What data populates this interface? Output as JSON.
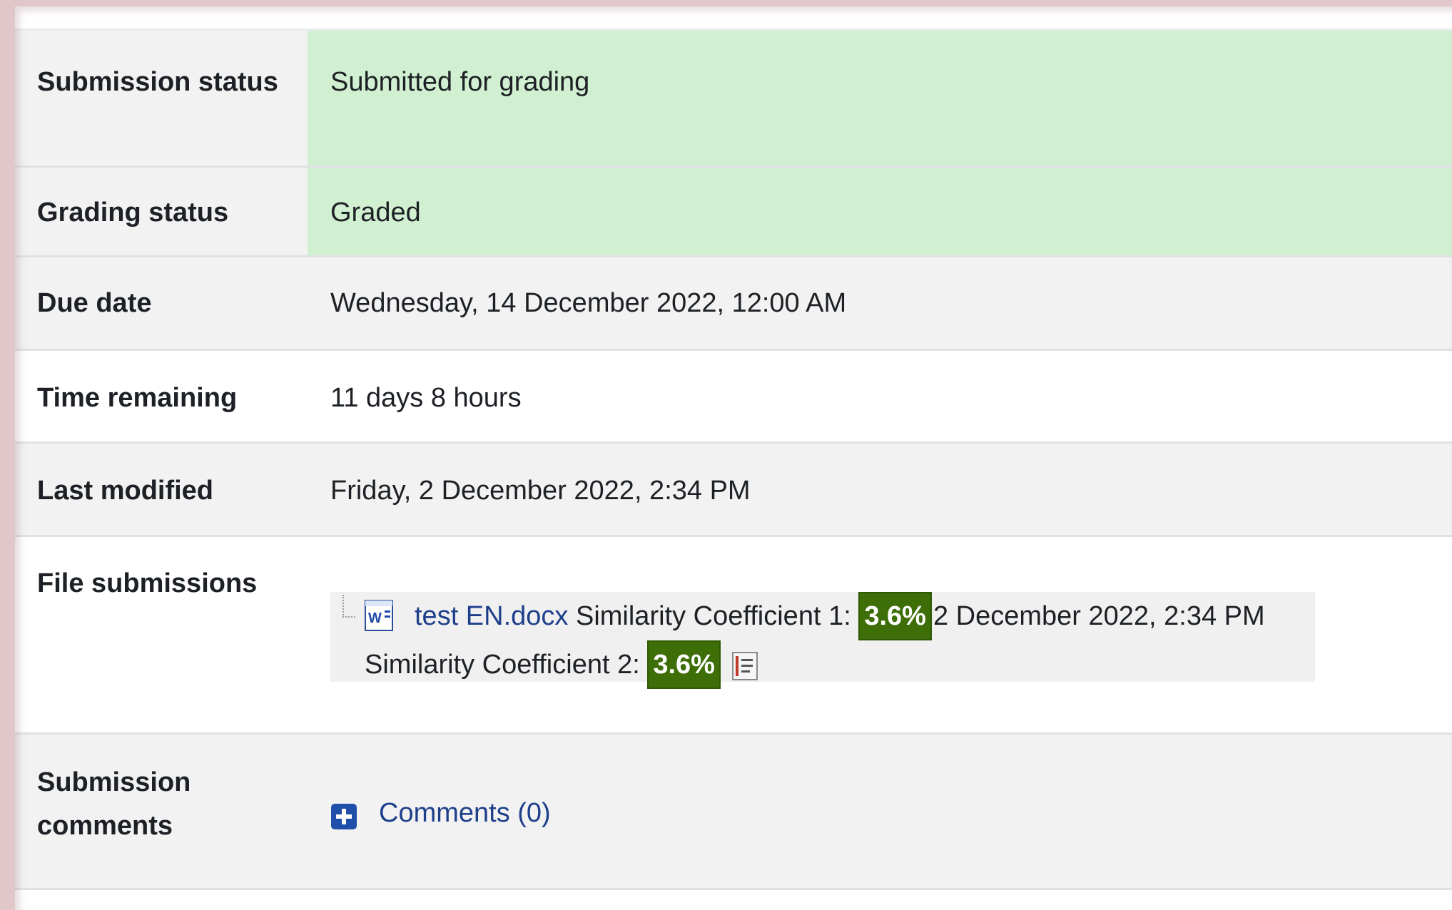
{
  "status": {
    "submission_status": {
      "label": "Submission status",
      "value": "Submitted for grading"
    },
    "grading_status": {
      "label": "Grading status",
      "value": "Graded"
    },
    "due_date": {
      "label": "Due date",
      "value": "Wednesday, 14 December 2022, 12:00 AM"
    },
    "time_remaining": {
      "label": "Time remaining",
      "value": "11 days 8 hours"
    },
    "last_modified": {
      "label": "Last modified",
      "value": "Friday, 2 December 2022, 2:34 PM"
    },
    "file_submissions": {
      "label": "File submissions",
      "file": {
        "icon": "word-document-icon",
        "name": "test EN.docx",
        "similarity_1_label": "Similarity Coefficient 1:",
        "similarity_1_value": "3.6%",
        "date": "2 December 2022, 2:34 PM",
        "similarity_2_label": "Similarity Coefficient 2:",
        "similarity_2_value": "3.6%",
        "report_icon": "report-icon"
      }
    },
    "submission_comments": {
      "label": "Submission comments",
      "toggle_icon": "plus-square-icon",
      "link": "Comments (0)"
    }
  },
  "colors": {
    "success_bg": "#d1f0d1",
    "row_gray": "#f2f2f2",
    "link": "#1e3f8a",
    "badge_bg": "#3d6e08",
    "frame": "#e2c7ca"
  }
}
